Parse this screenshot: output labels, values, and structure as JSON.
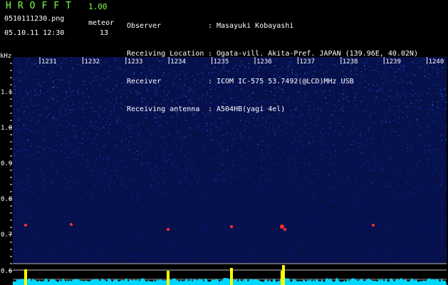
{
  "app": {
    "title": "HROFFT",
    "version": "1.00"
  },
  "file": {
    "name": "0510111230.png",
    "datetime": "05.10.11 12:30"
  },
  "meteor": {
    "label": "meteor",
    "count": "13"
  },
  "info": [
    {
      "key": "Observer",
      "value": "Masayuki Kobayashi"
    },
    {
      "key": "Receiving Location",
      "value": "Ogata-vill. Akita-Pref. JAPAN (139.96E, 40.02N)"
    },
    {
      "key": "Receiver",
      "value": "ICOM IC-575 53.7492(@LCD)MHz USB"
    },
    {
      "key": "Receiving antenna",
      "value": "A504HB(yagi 4el)"
    }
  ],
  "spectrogram": {
    "y_unit": "kHz",
    "y_ticks": [
      "1.1",
      "1.0",
      "0.9",
      "0.8",
      "0.7",
      "0.6"
    ],
    "time_marks": [
      "1231",
      "1232",
      "1233",
      "1234",
      "1235",
      "1236",
      "1237",
      "1238",
      "1239",
      "1240"
    ],
    "colors": {
      "background": "#000000",
      "noise_low": "#0a1a8a",
      "noise_high": "#3a7cff",
      "echo": "#ff3030",
      "level_trace": "#00d8ff",
      "level_peak": "#ffff00",
      "label_green": "#7cff4a"
    }
  }
}
